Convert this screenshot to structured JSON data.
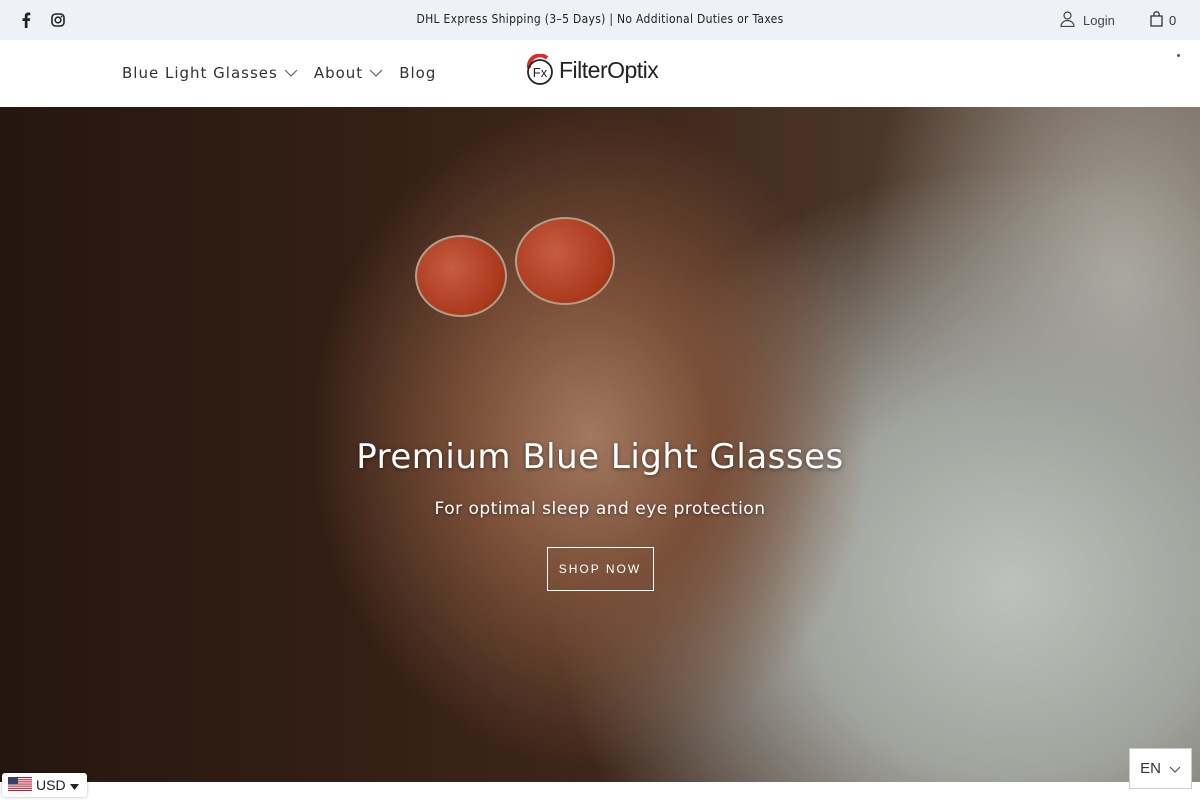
{
  "topbar": {
    "social": [
      {
        "icon": "facebook-icon"
      },
      {
        "icon": "instagram-icon"
      }
    ],
    "announcement": "DHL Express Shipping (3–5 Days) | No Additional Duties or Taxes",
    "login_label": "Login",
    "cart_count": "0"
  },
  "header": {
    "nav": [
      {
        "label": "Blue Light Glasses",
        "has_dropdown": true
      },
      {
        "label": "About",
        "has_dropdown": true
      },
      {
        "label": "Blog",
        "has_dropdown": false
      }
    ],
    "logo_text": "FilterOptix",
    "logo_mark_text": "Fx",
    "accent_color": "#e32626"
  },
  "hero": {
    "title": "Premium Blue Light Glasses",
    "subtitle": "For optimal sleep and eye protection",
    "cta_label": "SHOP NOW"
  },
  "widgets": {
    "currency": "USD",
    "language": "EN"
  }
}
